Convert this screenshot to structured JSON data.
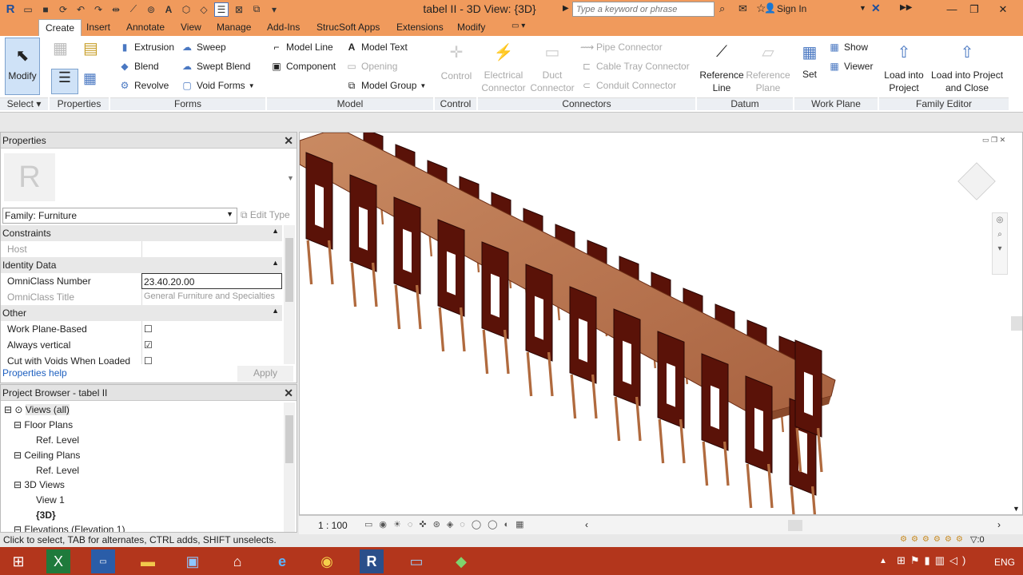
{
  "titlebar": {
    "title": "tabel II - 3D View: {3D}",
    "search_placeholder": "Type a keyword or phrase",
    "signin": "Sign In"
  },
  "tabs": [
    "Create",
    "Insert",
    "Annotate",
    "View",
    "Manage",
    "Add-Ins",
    "StrucSoft Apps",
    "Extensions",
    "Modify"
  ],
  "ribbon": {
    "modify": "Modify",
    "forms": [
      "Extrusion",
      "Blend",
      "Revolve",
      "Sweep",
      "Swept Blend",
      "Void Forms"
    ],
    "model": [
      "Model Line",
      "Component",
      "Model Text",
      "Opening",
      "Model Group"
    ],
    "control": "Control",
    "connectors": [
      "Electrical Connector",
      "Duct Connector",
      "Pipe Connector",
      "Cable Tray Connector",
      "Conduit Connector"
    ],
    "datum": [
      "Reference Line",
      "Reference Plane"
    ],
    "workplane": [
      "Set",
      "Show",
      "Viewer"
    ],
    "family_editor": [
      "Load into Project",
      "Load into Project and Close"
    ],
    "panels": [
      "Select",
      "Properties",
      "Forms",
      "Model",
      "Control",
      "Connectors",
      "Datum",
      "Work Plane",
      "Family Editor"
    ]
  },
  "properties": {
    "title": "Properties",
    "family": "Family: Furniture",
    "edit_type": "Edit Type",
    "groups": [
      "Constraints",
      "Identity Data",
      "Other"
    ],
    "rows": {
      "host": "Host",
      "omni_number_label": "OmniClass Number",
      "omni_number_value": "23.40.20.00",
      "omni_title_label": "OmniClass Title",
      "omni_title_value": "General Furniture and Specialties",
      "work_plane": "Work Plane-Based",
      "always_vertical": "Always vertical",
      "cut_voids": "Cut with Voids When Loaded"
    },
    "help": "Properties help",
    "apply": "Apply"
  },
  "browser": {
    "title": "Project Browser - tabel II",
    "items": [
      "Views (all)",
      "Floor Plans",
      "Ref. Level",
      "Ceiling Plans",
      "Ref. Level",
      "3D Views",
      "View 1",
      "{3D}",
      "Elevations (Elevation 1)"
    ]
  },
  "viewbar": {
    "scale": "1 : 100"
  },
  "status": "Click to select, TAB for alternates, CTRL adds, SHIFT unselects.",
  "taskbar": {
    "lang": "ENG"
  },
  "colors": {
    "accent": "#f09a5c",
    "taskbar": "#b3361c",
    "chair": "#5a1208",
    "table": "#c07a52"
  }
}
